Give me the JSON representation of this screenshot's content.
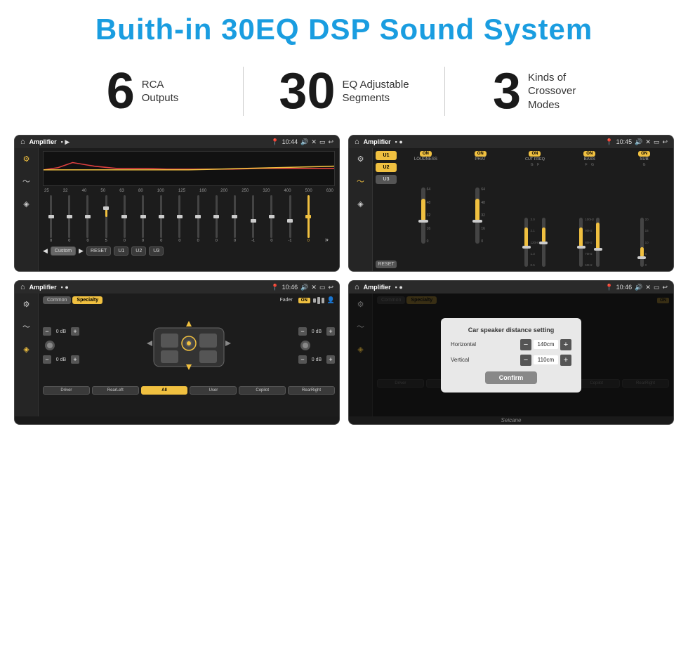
{
  "header": {
    "title": "Buith-in 30EQ DSP Sound System"
  },
  "stats": [
    {
      "number": "6",
      "label_line1": "RCA",
      "label_line2": "Outputs"
    },
    {
      "number": "30",
      "label_line1": "EQ Adjustable",
      "label_line2": "Segments"
    },
    {
      "number": "3",
      "label_line1": "Kinds of",
      "label_line2": "Crossover Modes"
    }
  ],
  "screens": {
    "screen1": {
      "title": "Amplifier",
      "time": "10:44",
      "freq_labels": [
        "25",
        "32",
        "40",
        "50",
        "63",
        "80",
        "100",
        "125",
        "160",
        "200",
        "250",
        "320",
        "400",
        "500",
        "630"
      ],
      "eq_values": [
        "0",
        "0",
        "0",
        "5",
        "0",
        "0",
        "0",
        "0",
        "0",
        "0",
        "0",
        "-1",
        "0",
        "-1"
      ],
      "buttons": [
        "Custom",
        "RESET",
        "U1",
        "U2",
        "U3"
      ]
    },
    "screen2": {
      "title": "Amplifier",
      "time": "10:45",
      "channels": [
        "LOUDNESS",
        "PHAT",
        "CUT FREQ",
        "BASS",
        "SUB"
      ],
      "u_buttons": [
        "U1",
        "U2",
        "U3"
      ],
      "toggles": [
        "ON",
        "ON",
        "ON",
        "ON",
        "ON"
      ]
    },
    "screen3": {
      "title": "Amplifier",
      "time": "10:46",
      "tabs": [
        "Common",
        "Specialty"
      ],
      "fader_label": "Fader",
      "fader_on": "ON",
      "db_values": [
        "0 dB",
        "0 dB",
        "0 dB",
        "0 dB"
      ],
      "bottom_buttons": [
        "Driver",
        "RearLeft",
        "All",
        "User",
        "Copilot",
        "RearRight"
      ]
    },
    "screen4": {
      "title": "Amplifier",
      "time": "10:46",
      "tabs": [
        "Common",
        "Specialty"
      ],
      "dialog": {
        "title": "Car speaker distance setting",
        "horizontal_label": "Horizontal",
        "horizontal_value": "140cm",
        "vertical_label": "Vertical",
        "vertical_value": "110cm",
        "confirm_label": "Confirm",
        "db_right1": "0 dB",
        "db_right2": "0 dB"
      },
      "bottom_buttons": [
        "Driver",
        "RearLeft",
        "All",
        "User",
        "Copilot",
        "RearRight"
      ]
    }
  },
  "watermark": "Seicane"
}
